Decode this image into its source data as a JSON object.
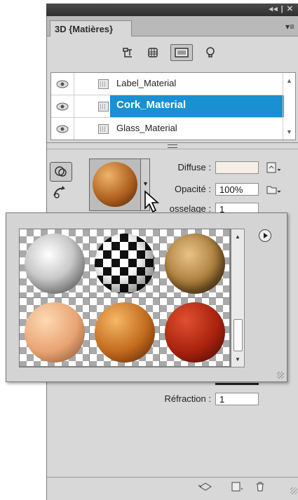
{
  "panel": {
    "collapse_controls": "◂◂ | ✕",
    "tab_title": "3D {Matières}",
    "panel_menu_icon": "panel-menu-icon"
  },
  "filter_icons": [
    "scene-filter-icon",
    "mesh-filter-icon",
    "materials-filter-icon",
    "light-filter-icon"
  ],
  "materials": [
    {
      "label": "Label_Material",
      "selected": false
    },
    {
      "label": "Cork_Material",
      "selected": true
    },
    {
      "label": "Glass_Material",
      "selected": false
    }
  ],
  "properties": {
    "diffuse_label": "Diffuse :",
    "opacity_label": "Opacité :",
    "opacity_value": "100%",
    "bump_label": "osselage :",
    "bump_value": "1",
    "refraction_label": "Réfraction :",
    "refraction_value": "1"
  },
  "preset_popup": {
    "swatches": [
      "white-stone",
      "checker",
      "cork-rough",
      "skin",
      "cork",
      "red-plastic"
    ]
  },
  "colors": {
    "selection": "#1a8fd2",
    "panel_bg": "#d8d8d8"
  }
}
